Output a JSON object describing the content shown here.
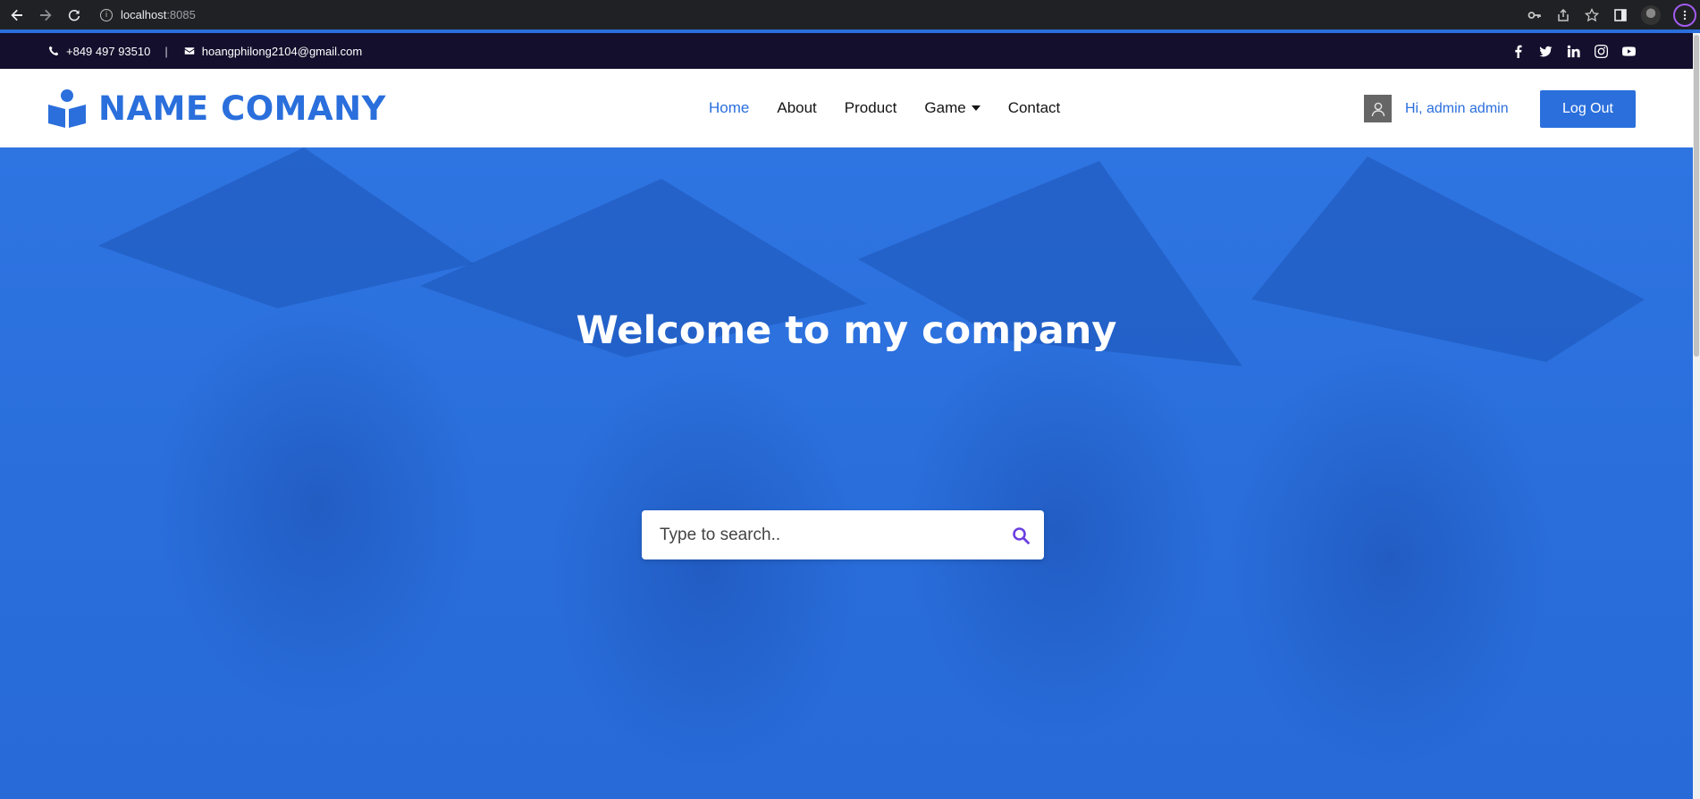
{
  "browser": {
    "url_host": "localhost",
    "url_port": ":8085"
  },
  "topbar": {
    "phone": "+849 497 93510",
    "separator": "|",
    "email": "hoangphilong2104@gmail.com",
    "socials": [
      "facebook-icon",
      "twitter-icon",
      "linkedin-icon",
      "instagram-icon",
      "youtube-icon"
    ]
  },
  "header": {
    "brand": "NAME COMANY",
    "nav": [
      {
        "label": "Home",
        "active": true
      },
      {
        "label": "About"
      },
      {
        "label": "Product"
      },
      {
        "label": "Game",
        "dropdown": true
      },
      {
        "label": "Contact"
      }
    ],
    "greeting": "Hi, admin admin",
    "logout_label": "Log Out"
  },
  "hero": {
    "title": "Welcome to my company",
    "search_placeholder": "Type to search.."
  },
  "colors": {
    "accent": "#2a6fdc",
    "topbar_bg": "#140f2d",
    "search_icon": "#6b3fe0"
  }
}
